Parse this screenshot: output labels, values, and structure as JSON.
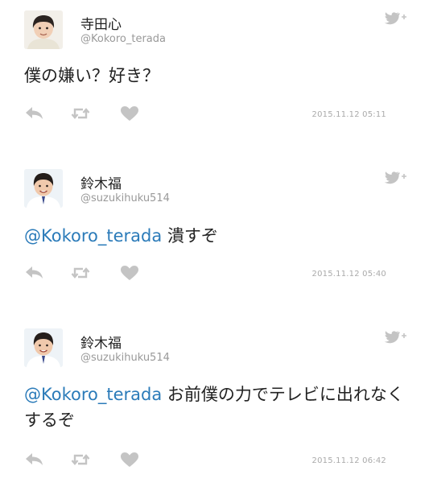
{
  "tweets": [
    {
      "name": "寺田心",
      "handle": "@Kokoro_terada",
      "mention": "",
      "text": "僕の嫌い？好き？",
      "timestamp": "2015.11.12 05:11"
    },
    {
      "name": "鈴木福",
      "handle": "@suzukihuku514",
      "mention": "@Kokoro_terada",
      "text": " 潰すぞ",
      "timestamp": "2015.11.12 05:40"
    },
    {
      "name": "鈴木福",
      "handle": "@suzukihuku514",
      "mention": "@Kokoro_terada",
      "text": " お前僕の力でテレビに出れなくするぞ",
      "timestamp": "2015.11.12 06:42"
    }
  ],
  "icons": {
    "reply": "reply-icon",
    "retweet": "retweet-icon",
    "like": "heart-icon",
    "follow": "twitter-bird-follow-icon"
  },
  "colors": {
    "mention": "#2b7bb9",
    "icon": "#c4c4c4",
    "text": "#222222",
    "muted": "#999999"
  }
}
